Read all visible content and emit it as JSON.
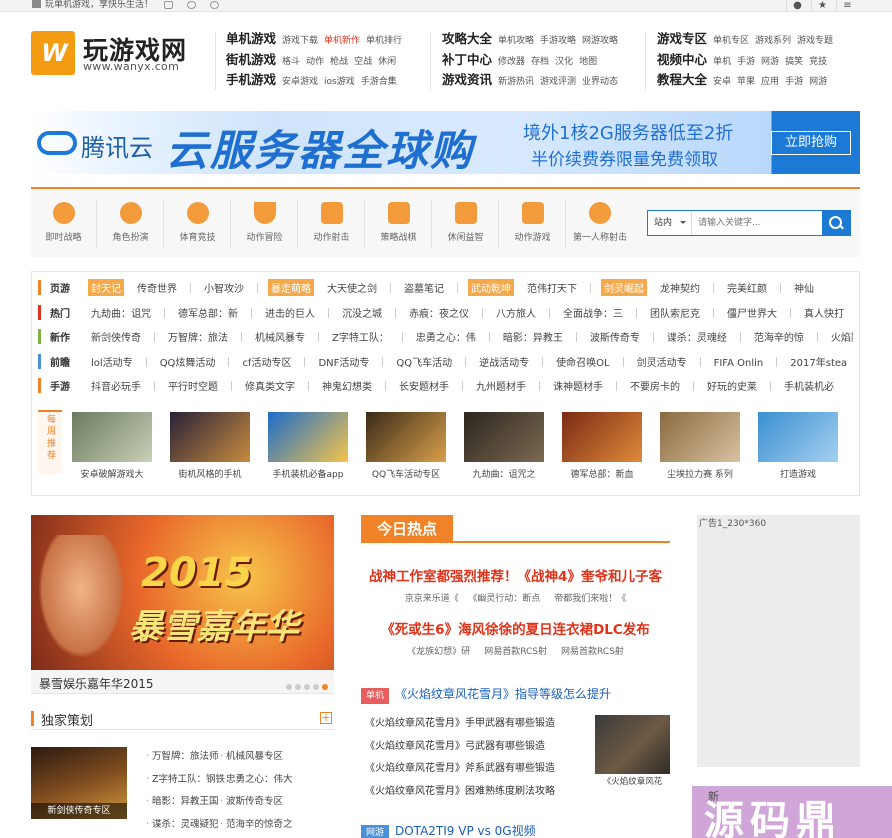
{
  "topbar": {
    "slogan": "玩单机游戏，享快乐生活！",
    "right_icons": [
      "user-icon",
      "star-icon",
      "menu-icon"
    ]
  },
  "logo": {
    "cn": "玩游戏网",
    "url": "www.wanyx.com",
    "mark": "W"
  },
  "nav": [
    {
      "rows": [
        {
          "main": "单机游戏",
          "subs": [
            {
              "t": "游戏下载"
            },
            {
              "t": "单机新作",
              "red": true
            },
            {
              "t": "单机排行"
            }
          ]
        },
        {
          "main": "街机游戏",
          "subs": [
            {
              "t": "格斗"
            },
            {
              "t": "动作"
            },
            {
              "t": "枪战"
            },
            {
              "t": "空战"
            },
            {
              "t": "休闲"
            }
          ]
        },
        {
          "main": "手机游戏",
          "subs": [
            {
              "t": "安卓游戏"
            },
            {
              "t": "ios游戏"
            },
            {
              "t": "手游合集"
            }
          ]
        }
      ]
    },
    {
      "rows": [
        {
          "main": "攻略大全",
          "subs": [
            {
              "t": "单机攻略"
            },
            {
              "t": "手游攻略"
            },
            {
              "t": "网游攻略"
            }
          ]
        },
        {
          "main": "补丁中心",
          "subs": [
            {
              "t": "修改器"
            },
            {
              "t": "存档"
            },
            {
              "t": "汉化"
            },
            {
              "t": "地图"
            }
          ]
        },
        {
          "main": "游戏资讯",
          "subs": [
            {
              "t": "新游热讯"
            },
            {
              "t": "游戏评测"
            },
            {
              "t": "业界动态"
            }
          ]
        }
      ]
    },
    {
      "rows": [
        {
          "main": "游戏专区",
          "subs": [
            {
              "t": "单机专区"
            },
            {
              "t": "游戏系列"
            },
            {
              "t": "游戏专题"
            }
          ]
        },
        {
          "main": "视频中心",
          "subs": [
            {
              "t": "单机"
            },
            {
              "t": "手游"
            },
            {
              "t": "网游"
            },
            {
              "t": "搞笑"
            },
            {
              "t": "竞技"
            }
          ]
        },
        {
          "main": "教程大全",
          "subs": [
            {
              "t": "安卓"
            },
            {
              "t": "苹果"
            },
            {
              "t": "应用"
            },
            {
              "t": "手游"
            },
            {
              "t": "网游"
            }
          ]
        }
      ]
    }
  ],
  "banner": {
    "brand": "腾讯云",
    "headline": "云服务器全球购",
    "line1": "境外1核2G服务器低至2折",
    "line2": "半价续费券限量免费领取",
    "button": "立即抢购"
  },
  "categories": [
    {
      "label": "即时战略",
      "icon": "head-icon"
    },
    {
      "label": "角色扮演",
      "icon": "mask-icon"
    },
    {
      "label": "体育竞技",
      "icon": "ball-icon"
    },
    {
      "label": "动作冒险",
      "icon": "shield-icon"
    },
    {
      "label": "动作射击",
      "icon": "gun-icon"
    },
    {
      "label": "策略战棋",
      "icon": "chess-knight-icon"
    },
    {
      "label": "休闲益智",
      "icon": "puzzle-icon"
    },
    {
      "label": "动作游戏",
      "icon": "fist-icon"
    },
    {
      "label": "第一人称射击",
      "icon": "crosshair-icon"
    }
  ],
  "search": {
    "scope": "站内",
    "placeholder": "请输入关键字..."
  },
  "tag_rows": [
    {
      "label": "页游",
      "color": "#f08228",
      "items": [
        {
          "t": "封天记",
          "hl": true
        },
        {
          "t": "传奇世界"
        },
        {
          "t": "小智攻沙"
        },
        {
          "t": "暴走萌略",
          "hl": true
        },
        {
          "t": "大天使之剑"
        },
        {
          "t": "盗墓笔记"
        },
        {
          "t": "武动乾坤",
          "hl": true
        },
        {
          "t": "范伟打天下"
        },
        {
          "t": "剑灵崛起",
          "hl": true
        },
        {
          "t": "龙神契约"
        },
        {
          "t": "完美红颜"
        },
        {
          "t": "神仙"
        }
      ]
    },
    {
      "label": "热门",
      "color": "#e0331a",
      "items": [
        {
          "t": "九劫曲：诅咒"
        },
        {
          "t": "德军总部：新"
        },
        {
          "t": "进击的巨人"
        },
        {
          "t": "沉没之城"
        },
        {
          "t": "赤痕：夜之仪"
        },
        {
          "t": "八方旅人"
        },
        {
          "t": "全面战争：三"
        },
        {
          "t": "团队索尼克"
        },
        {
          "t": "僵尸世界大"
        },
        {
          "t": "真人快打"
        }
      ]
    },
    {
      "label": "新作",
      "color": "#7cb342",
      "items": [
        {
          "t": "新剑侠传奇"
        },
        {
          "t": "万智牌：旅法"
        },
        {
          "t": "机械风暴专"
        },
        {
          "t": "Z字特工队："
        },
        {
          "t": "忠勇之心：伟"
        },
        {
          "t": "暗影：异教王"
        },
        {
          "t": "波斯传奇专"
        },
        {
          "t": "谍杀：灵魂经"
        },
        {
          "t": "范海辛的惊"
        },
        {
          "t": "火焰限"
        }
      ]
    },
    {
      "label": "前瞻",
      "color": "#4a90d9",
      "items": [
        {
          "t": "lol活动专"
        },
        {
          "t": "QQ炫舞活动"
        },
        {
          "t": "cf活动专区"
        },
        {
          "t": "DNF活动专"
        },
        {
          "t": "QQ飞车活动"
        },
        {
          "t": "逆战活动专"
        },
        {
          "t": "使命召唤OL"
        },
        {
          "t": "剑灵活动专"
        },
        {
          "t": "FIFA Onlin"
        },
        {
          "t": "2017年stea"
        }
      ]
    },
    {
      "label": "手游",
      "color": "#f08228",
      "items": [
        {
          "t": "抖音必玩手"
        },
        {
          "t": "平行时空题"
        },
        {
          "t": "修真类文字"
        },
        {
          "t": "神鬼幻想类"
        },
        {
          "t": "长安题材手"
        },
        {
          "t": "九州题材手"
        },
        {
          "t": "诛神题材手"
        },
        {
          "t": "不要房卡的"
        },
        {
          "t": "好玩的史莱"
        },
        {
          "t": "手机装机必"
        }
      ]
    }
  ],
  "weekly": {
    "label": "每周推荐"
  },
  "thumbs": [
    {
      "cap": "安卓破解游戏大",
      "c1": "#6b7a5c",
      "c2": "#c9d0b8"
    },
    {
      "cap": "街机风格的手机",
      "c1": "#2a2238",
      "c2": "#c78b3e"
    },
    {
      "cap": "手机装机必备app",
      "c1": "#1d6ccc",
      "c2": "#f4c44a"
    },
    {
      "cap": "QQ飞车活动专区",
      "c1": "#3a2a18",
      "c2": "#d9a04a"
    },
    {
      "cap": "九劫曲：诅咒之",
      "c1": "#2c261f",
      "c2": "#7c6a52"
    },
    {
      "cap": "德军总部：新血",
      "c1": "#7a2a14",
      "c2": "#e08a3a"
    },
    {
      "cap": "尘埃拉力赛 系列",
      "c1": "#8a6a40",
      "c2": "#d8c2a0"
    },
    {
      "cap": "打造游戏",
      "c1": "#3a8fd1",
      "c2": "#a5d0f0"
    }
  ],
  "feature": {
    "year": "2015",
    "title": "暴雪嘉年华",
    "caption": "暴雪娱乐嘉年华2015",
    "dots": 5,
    "active_dot": 4
  },
  "exclusive": {
    "title": "独家策划",
    "image_caption": "新剑侠传奇专区",
    "col1": [
      "万智牌：旅法师",
      "Z字特工队：钢铁",
      "暗影：异教王国",
      "谍杀：灵魂疑犯"
    ],
    "col2": [
      "机械风暴专区",
      "忠勇之心：伟大",
      "波斯传奇专区",
      "范海辛的惊奇之"
    ]
  },
  "hot": {
    "title": "今日热点",
    "headline1": "战神工作室都强烈推荐！《战神4》奎爷和儿子客",
    "subs1": [
      "京京来乐道《",
      "《幽灵行动：断点",
      "帝都我们来啦！《"
    ],
    "headline2": "《死或生6》海风徐徐的夏日连衣裙DLC发布",
    "subs2": [
      "《龙族幻想》研",
      "网易首款RCS射",
      "网易首款RCS射"
    ],
    "news_tag": "单机",
    "news_lead": "《火焰纹章风花雪月》指导等级怎么提升",
    "news_list": [
      "《火焰纹章风花雪月》手甲武器有哪些锻造",
      "《火焰纹章风花雪月》弓武器有哪些锻造",
      "《火焰纹章风花雪月》斧系武器有哪些锻造",
      "《火焰纹章风花雪月》困难熟练度刷法攻略"
    ],
    "news_pic_caption": "《火焰纹章风花",
    "news2_tag": "网游",
    "news2_lead": "DOTA2TI9 VP vs 0G视频"
  },
  "ad": {
    "label": "广告1_230*360"
  },
  "watermark": {
    "big": "源码鼎",
    "small": "新"
  }
}
